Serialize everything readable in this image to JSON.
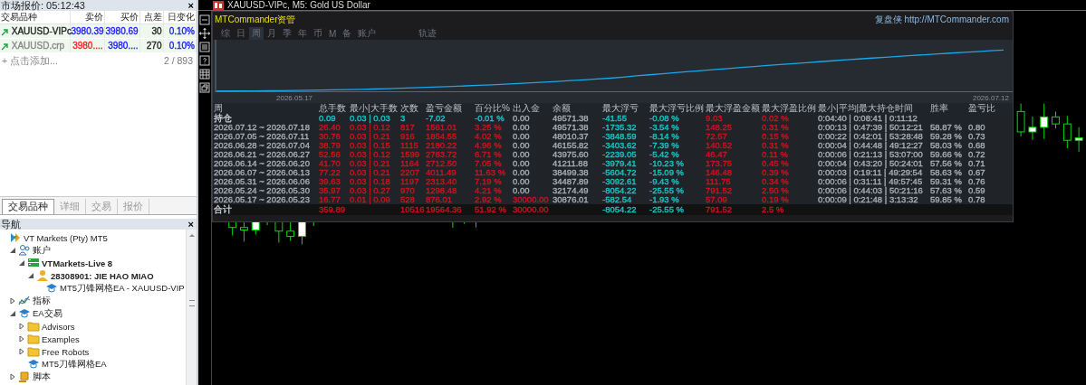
{
  "market_watch": {
    "title": "市场报价: 05:12:43",
    "close": "×",
    "columns": [
      "交易品种",
      "卖价",
      "买价",
      "点差",
      "日变化"
    ],
    "rows": [
      {
        "symbol": "XAUUSD-VIPc",
        "dimmed": false,
        "bid": {
          "text": "3980.39",
          "color": "#1a1aff"
        },
        "ask": "3980.69",
        "spread": "30",
        "change": "0.10%"
      },
      {
        "symbol": "XAUUSD.crp",
        "dimmed": true,
        "bid": {
          "text": "3980....",
          "color": "#ff2020"
        },
        "ask": "3980....",
        "spread": "270",
        "change": "0.10%"
      }
    ],
    "add": "+ 点击添加...",
    "count": "2 / 893"
  },
  "left_tabs": [
    {
      "label": "交易品种",
      "selected": true
    },
    {
      "label": "详细",
      "selected": false
    },
    {
      "label": "交易",
      "selected": false
    },
    {
      "label": "报价",
      "selected": false
    }
  ],
  "navigator": {
    "title": "导航",
    "close": "×",
    "tree": [
      {
        "label": "VT Markets (Pty) MT5",
        "kind": "broker",
        "bold": false,
        "children": [
          {
            "label": "账户",
            "kind": "accounts",
            "bold": false,
            "expanded": true,
            "children": [
              {
                "label": "VTMarkets-Live 8",
                "kind": "server",
                "bold": true,
                "expanded": true,
                "children": [
                  {
                    "label": "28308901: JIE HAO MIAO",
                    "kind": "user",
                    "bold": true,
                    "expanded": true,
                    "children": [
                      {
                        "label": "MT5刀锋网格EA - XAUUSD-VIP",
                        "kind": "ea",
                        "bold": false
                      }
                    ]
                  }
                ]
              }
            ]
          },
          {
            "label": "指标",
            "kind": "indicators",
            "bold": false,
            "expanded": false
          },
          {
            "label": "EA交易",
            "kind": "ea",
            "bold": false,
            "expanded": true,
            "children": [
              {
                "label": "Advisors",
                "kind": "folder",
                "bold": false,
                "expanded": false
              },
              {
                "label": "Examples",
                "kind": "folder",
                "bold": false,
                "expanded": false
              },
              {
                "label": "Free Robots",
                "kind": "folder",
                "bold": false,
                "expanded": false
              },
              {
                "label": "MT5刀锋网格EA",
                "kind": "ea",
                "bold": false
              }
            ]
          },
          {
            "label": "脚本",
            "kind": "scripts",
            "bold": false,
            "expanded": false
          }
        ]
      }
    ]
  },
  "chart_window": {
    "title": "XAUUSD-VIPc, M5:  Gold US Dollar"
  },
  "panel": {
    "title": "MTCommander资管",
    "brand": "复盘侠",
    "url": "http://MTCommander.com",
    "tabs": [
      {
        "label": "综",
        "selected": false
      },
      {
        "label": "日",
        "selected": false
      },
      {
        "label": "周",
        "selected": true
      },
      {
        "label": "月",
        "selected": false
      },
      {
        "label": "季",
        "selected": false
      },
      {
        "label": "年",
        "selected": false
      },
      {
        "label": "币",
        "selected": false
      },
      {
        "label": "M",
        "selected": false
      },
      {
        "label": "备",
        "selected": false
      },
      {
        "label": "账户",
        "selected": false
      },
      {
        "label": "轨迹",
        "selected": false
      }
    ],
    "equity_dates": [
      "2026.05.17",
      "2026.07.12"
    ],
    "columns": [
      "周",
      "总手数",
      "最小|大手数",
      "次数",
      "盈亏金额",
      "百分比%",
      "出入金",
      "余额",
      "最大浮亏",
      "最大浮亏比例",
      "最大浮盈金额",
      "最大浮盈比例",
      "最小|平均|最大持仓时间",
      "胜率",
      "盈亏比"
    ],
    "rows": [
      {
        "kind": "holding",
        "cells": [
          {
            "text": "持仓",
            "color": "#c8d0d8"
          },
          {
            "text": "0.09",
            "color": "#18c8c8"
          },
          {
            "text": "0.03 | 0.03",
            "color": "#18c8c8"
          },
          {
            "text": "3",
            "color": "#18c8c8"
          },
          {
            "text": "-7.02",
            "color": "#18c8c8"
          },
          {
            "text": "-0.01 %",
            "color": "#18c8c8"
          },
          {
            "text": "0.00",
            "color": "#a8b0b8"
          },
          {
            "text": "49571.38",
            "color": "#a8b0b8"
          },
          {
            "text": "-41.55",
            "color": "#18c8c8"
          },
          {
            "text": "-0.08 %",
            "color": "#18c8c8"
          },
          {
            "text": "9.03",
            "color": "#d0141e"
          },
          {
            "text": "0.02 %",
            "color": "#d0141e"
          },
          {
            "text": "0:04:40 | 0:08:41 | 0:11:12",
            "color": "#a8b0b8"
          },
          null,
          null
        ]
      },
      {
        "kind": "week",
        "cells": [
          {
            "text": "2026.07.12 ~ 2026.07.18",
            "color": "#a8b0b8"
          },
          {
            "text": "26.40",
            "color": "#d0141e"
          },
          {
            "text": "0.03 | 0.12",
            "color": "#d0141e"
          },
          {
            "text": "817",
            "color": "#d0141e"
          },
          {
            "text": "1561.01",
            "color": "#d0141e"
          },
          {
            "text": "3.25 %",
            "color": "#d0141e"
          },
          {
            "text": "0.00",
            "color": "#a8b0b8"
          },
          {
            "text": "49571.38",
            "color": "#a8b0b8"
          },
          {
            "text": "-1735.32",
            "color": "#18c8c8"
          },
          {
            "text": "-3.54 %",
            "color": "#18c8c8"
          },
          {
            "text": "148.25",
            "color": "#d0141e"
          },
          {
            "text": "0.31 %",
            "color": "#d0141e"
          },
          {
            "text": "0:00:13 | 0:47:39 | 50:12:21",
            "color": "#a8b0b8"
          },
          {
            "text": "58.87 %",
            "color": "#a8b0b8"
          },
          {
            "text": "0.80",
            "color": "#a8b0b8"
          }
        ]
      },
      {
        "kind": "week",
        "cells": [
          {
            "text": "2026.07.05 ~ 2026.07.11",
            "color": "#a8b0b8"
          },
          {
            "text": "30.76",
            "color": "#d0141e"
          },
          {
            "text": "0.03 | 0.21",
            "color": "#d0141e"
          },
          {
            "text": "916",
            "color": "#d0141e"
          },
          {
            "text": "1854.55",
            "color": "#d0141e"
          },
          {
            "text": "4.02 %",
            "color": "#d0141e"
          },
          {
            "text": "0.00",
            "color": "#a8b0b8"
          },
          {
            "text": "48010.37",
            "color": "#a8b0b8"
          },
          {
            "text": "-3848.59",
            "color": "#18c8c8"
          },
          {
            "text": "-8.14 %",
            "color": "#18c8c8"
          },
          {
            "text": "72.57",
            "color": "#d0141e"
          },
          {
            "text": "0.15 %",
            "color": "#d0141e"
          },
          {
            "text": "0:00:22 | 0:42:01 | 53:28:48",
            "color": "#a8b0b8"
          },
          {
            "text": "59.28 %",
            "color": "#a8b0b8"
          },
          {
            "text": "0.73",
            "color": "#a8b0b8"
          }
        ]
      },
      {
        "kind": "week",
        "cells": [
          {
            "text": "2026.06.28 ~ 2026.07.04",
            "color": "#a8b0b8"
          },
          {
            "text": "38.79",
            "color": "#d0141e"
          },
          {
            "text": "0.03 | 0.15",
            "color": "#d0141e"
          },
          {
            "text": "1115",
            "color": "#d0141e"
          },
          {
            "text": "2180.22",
            "color": "#d0141e"
          },
          {
            "text": "4.96 %",
            "color": "#d0141e"
          },
          {
            "text": "0.00",
            "color": "#a8b0b8"
          },
          {
            "text": "46155.82",
            "color": "#a8b0b8"
          },
          {
            "text": "-3403.62",
            "color": "#18c8c8"
          },
          {
            "text": "-7.39 %",
            "color": "#18c8c8"
          },
          {
            "text": "140.52",
            "color": "#d0141e"
          },
          {
            "text": "0.31 %",
            "color": "#d0141e"
          },
          {
            "text": "0:00:04 | 0:44:48 | 49:12:27",
            "color": "#a8b0b8"
          },
          {
            "text": "58.03 %",
            "color": "#a8b0b8"
          },
          {
            "text": "0.68",
            "color": "#a8b0b8"
          }
        ]
      },
      {
        "kind": "week",
        "cells": [
          {
            "text": "2026.06.21 ~ 2026.06.27",
            "color": "#a8b0b8"
          },
          {
            "text": "52.56",
            "color": "#d0141e"
          },
          {
            "text": "0.03 | 0.12",
            "color": "#d0141e"
          },
          {
            "text": "1599",
            "color": "#d0141e"
          },
          {
            "text": "2763.72",
            "color": "#d0141e"
          },
          {
            "text": "6.71 %",
            "color": "#d0141e"
          },
          {
            "text": "0.00",
            "color": "#a8b0b8"
          },
          {
            "text": "43975.60",
            "color": "#a8b0b8"
          },
          {
            "text": "-2239.05",
            "color": "#18c8c8"
          },
          {
            "text": "-5.42 %",
            "color": "#18c8c8"
          },
          {
            "text": "46.47",
            "color": "#d0141e"
          },
          {
            "text": "0.11 %",
            "color": "#d0141e"
          },
          {
            "text": "0:00:06 | 0:21:13 | 53:07:00",
            "color": "#a8b0b8"
          },
          {
            "text": "59.66 %",
            "color": "#a8b0b8"
          },
          {
            "text": "0.72",
            "color": "#a8b0b8"
          }
        ]
      },
      {
        "kind": "week",
        "cells": [
          {
            "text": "2026.06.14 ~ 2026.06.20",
            "color": "#a8b0b8"
          },
          {
            "text": "41.70",
            "color": "#d0141e"
          },
          {
            "text": "0.03 | 0.21",
            "color": "#d0141e"
          },
          {
            "text": "1164",
            "color": "#d0141e"
          },
          {
            "text": "2712.50",
            "color": "#d0141e"
          },
          {
            "text": "7.05 %",
            "color": "#d0141e"
          },
          {
            "text": "0.00",
            "color": "#a8b0b8"
          },
          {
            "text": "41211.88",
            "color": "#a8b0b8"
          },
          {
            "text": "-3979.41",
            "color": "#18c8c8"
          },
          {
            "text": "-10.23 %",
            "color": "#18c8c8"
          },
          {
            "text": "173.75",
            "color": "#d0141e"
          },
          {
            "text": "0.45 %",
            "color": "#d0141e"
          },
          {
            "text": "0:00:04 | 0:43:20 | 50:24:01",
            "color": "#a8b0b8"
          },
          {
            "text": "57.56 %",
            "color": "#a8b0b8"
          },
          {
            "text": "0.71",
            "color": "#a8b0b8"
          }
        ]
      },
      {
        "kind": "week",
        "cells": [
          {
            "text": "2026.06.07 ~ 2026.06.13",
            "color": "#a8b0b8"
          },
          {
            "text": "77.22",
            "color": "#d0141e"
          },
          {
            "text": "0.03 | 0.21",
            "color": "#d0141e"
          },
          {
            "text": "2207",
            "color": "#d0141e"
          },
          {
            "text": "4011.49",
            "color": "#d0141e"
          },
          {
            "text": "11.63 %",
            "color": "#d0141e"
          },
          {
            "text": "0.00",
            "color": "#a8b0b8"
          },
          {
            "text": "38499.38",
            "color": "#a8b0b8"
          },
          {
            "text": "-5604.72",
            "color": "#18c8c8"
          },
          {
            "text": "-15.09 %",
            "color": "#18c8c8"
          },
          {
            "text": "146.48",
            "color": "#d0141e"
          },
          {
            "text": "0.39 %",
            "color": "#d0141e"
          },
          {
            "text": "0:00:03 | 0:19:11 | 49:29:54",
            "color": "#a8b0b8"
          },
          {
            "text": "58.63 %",
            "color": "#a8b0b8"
          },
          {
            "text": "0.67",
            "color": "#a8b0b8"
          }
        ]
      },
      {
        "kind": "week",
        "cells": [
          {
            "text": "2026.05.31 ~ 2026.06.06",
            "color": "#a8b0b8"
          },
          {
            "text": "39.63",
            "color": "#d0141e"
          },
          {
            "text": "0.03 | 0.18",
            "color": "#d0141e"
          },
          {
            "text": "1197",
            "color": "#d0141e"
          },
          {
            "text": "2313.40",
            "color": "#d0141e"
          },
          {
            "text": "7.19 %",
            "color": "#d0141e"
          },
          {
            "text": "0.00",
            "color": "#a8b0b8"
          },
          {
            "text": "34487.89",
            "color": "#a8b0b8"
          },
          {
            "text": "-3092.61",
            "color": "#18c8c8"
          },
          {
            "text": "-9.43 %",
            "color": "#18c8c8"
          },
          {
            "text": "111.75",
            "color": "#d0141e"
          },
          {
            "text": "0.34 %",
            "color": "#d0141e"
          },
          {
            "text": "0:00:06 | 0:31:11 | 49:57:45",
            "color": "#a8b0b8"
          },
          {
            "text": "59.31 %",
            "color": "#a8b0b8"
          },
          {
            "text": "0.76",
            "color": "#a8b0b8"
          }
        ]
      },
      {
        "kind": "week",
        "cells": [
          {
            "text": "2026.05.24 ~ 2026.05.30",
            "color": "#a8b0b8"
          },
          {
            "text": "35.97",
            "color": "#d0141e"
          },
          {
            "text": "0.03 | 0.27",
            "color": "#d0141e"
          },
          {
            "text": "970",
            "color": "#d0141e"
          },
          {
            "text": "1298.48",
            "color": "#d0141e"
          },
          {
            "text": "4.21 %",
            "color": "#d0141e"
          },
          {
            "text": "0.00",
            "color": "#a8b0b8"
          },
          {
            "text": "32174.49",
            "color": "#a8b0b8"
          },
          {
            "text": "-8054.22",
            "color": "#18c8c8"
          },
          {
            "text": "-25.55 %",
            "color": "#18c8c8"
          },
          {
            "text": "791.52",
            "color": "#d0141e"
          },
          {
            "text": "2.50 %",
            "color": "#d0141e"
          },
          {
            "text": "0:00:06 | 0:44:03 | 50:21:16",
            "color": "#a8b0b8"
          },
          {
            "text": "57.63 %",
            "color": "#a8b0b8"
          },
          {
            "text": "0.59",
            "color": "#a8b0b8"
          }
        ]
      },
      {
        "kind": "week",
        "cells": [
          {
            "text": "2026.05.17 ~ 2026.05.23",
            "color": "#a8b0b8"
          },
          {
            "text": "16.77",
            "color": "#d0141e"
          },
          {
            "text": "0.01 | 0.09",
            "color": "#d0141e"
          },
          {
            "text": "528",
            "color": "#d0141e"
          },
          {
            "text": "876.01",
            "color": "#d0141e"
          },
          {
            "text": "2.92 %",
            "color": "#d0141e"
          },
          {
            "text": "30000.00",
            "color": "#d0141e"
          },
          {
            "text": "30876.01",
            "color": "#a8b0b8"
          },
          {
            "text": "-582.54",
            "color": "#18c8c8"
          },
          {
            "text": "-1.93 %",
            "color": "#18c8c8"
          },
          {
            "text": "57.09",
            "color": "#d0141e"
          },
          {
            "text": "0.19 %",
            "color": "#d0141e"
          },
          {
            "text": "0:00:09 | 0:21:48 | 3:13:32",
            "color": "#a8b0b8"
          },
          {
            "text": "59.85 %",
            "color": "#a8b0b8"
          },
          {
            "text": "0.78",
            "color": "#a8b0b8"
          }
        ]
      },
      {
        "kind": "total",
        "cells": [
          {
            "text": "合计",
            "color": "#c8d0d8"
          },
          {
            "text": "359.89",
            "color": "#d0141e"
          },
          null,
          {
            "text": "10516",
            "color": "#d0141e"
          },
          {
            "text": "19564.36",
            "color": "#d0141e"
          },
          {
            "text": "51.92 %",
            "color": "#d0141e"
          },
          {
            "text": "30000.00",
            "color": "#d0141e"
          },
          null,
          {
            "text": "-8054.22",
            "color": "#18c8c8"
          },
          {
            "text": "-25.55 %",
            "color": "#18c8c8"
          },
          {
            "text": "791.52",
            "color": "#d0141e"
          },
          {
            "text": "2.5 %",
            "color": "#d0141e"
          },
          null,
          null,
          null
        ]
      }
    ]
  }
}
